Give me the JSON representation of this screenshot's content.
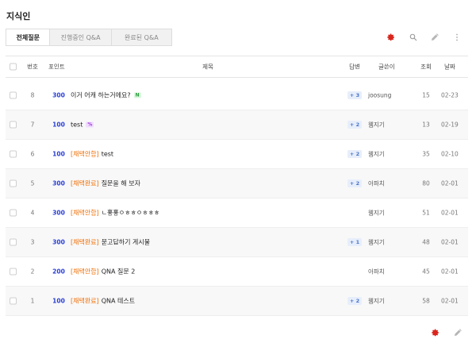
{
  "page": {
    "title": "지식인"
  },
  "tabs": [
    {
      "label": "전체질문",
      "active": true
    },
    {
      "label": "진행중인 Q&A",
      "active": false
    },
    {
      "label": "완료된 Q&A",
      "active": false
    }
  ],
  "colors": {
    "accent": "#d9251d",
    "points": "#2a3fd6",
    "status": "#ef6c00",
    "answer_badge_bg": "#e7eefb"
  },
  "toolbar_icons": [
    "gear-icon",
    "search-icon",
    "pencil-icon",
    "more-vertical-icon"
  ],
  "table": {
    "headers": {
      "number": "번호",
      "points": "포인트",
      "title": "제목",
      "answers": "답변",
      "writer": "글쓴이",
      "views": "조회",
      "date": "날짜"
    },
    "rows": [
      {
        "number": "8",
        "points": "300",
        "status": "",
        "title": "이거 어캐 하는거에요?",
        "badge": "N",
        "answers": "+ 3",
        "writer": "joosung",
        "views": "15",
        "date": "02-23"
      },
      {
        "number": "7",
        "points": "100",
        "status": "",
        "title": "test",
        "badge": "%",
        "answers": "+ 2",
        "writer": "웹지기",
        "views": "13",
        "date": "02-19"
      },
      {
        "number": "6",
        "points": "100",
        "status": "[채택안함]",
        "title": "test",
        "badge": "",
        "answers": "+ 2",
        "writer": "웹지기",
        "views": "35",
        "date": "02-10"
      },
      {
        "number": "5",
        "points": "300",
        "status": "[채택완료]",
        "title": "질문을 해 보자",
        "badge": "",
        "answers": "+ 2",
        "writer": "아파치",
        "views": "80",
        "date": "02-01"
      },
      {
        "number": "4",
        "points": "300",
        "status": "[채택안함]",
        "title": "ㄴ홓홓ㅇㅎㅎㅇㅎㅎㅎ",
        "badge": "",
        "answers": "",
        "writer": "웹지기",
        "views": "51",
        "date": "02-01"
      },
      {
        "number": "3",
        "points": "300",
        "status": "[채택완료]",
        "title": "묻고답하기 게시물",
        "badge": "",
        "answers": "+ 1",
        "writer": "웹지기",
        "views": "48",
        "date": "02-01"
      },
      {
        "number": "2",
        "points": "200",
        "status": "[채택안함]",
        "title": "QNA 질문 2",
        "badge": "",
        "answers": "",
        "writer": "아파치",
        "views": "45",
        "date": "02-01"
      },
      {
        "number": "1",
        "points": "100",
        "status": "[채택완료]",
        "title": "QNA 테스트",
        "badge": "",
        "answers": "+ 2",
        "writer": "웹지기",
        "views": "58",
        "date": "02-01"
      }
    ]
  },
  "footer_icons": [
    "gear-icon",
    "pencil-icon"
  ]
}
